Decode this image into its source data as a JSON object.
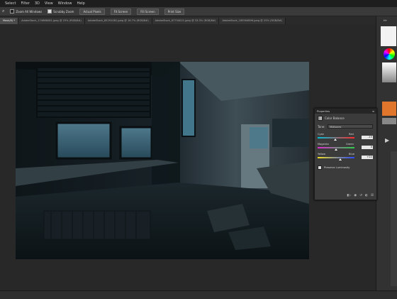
{
  "menubar": {
    "items": [
      "Select",
      "Filter",
      "3D",
      "View",
      "Window",
      "Help"
    ]
  },
  "options_bar": {
    "zoom_all_windows": "Zoom All Windows",
    "scrubby_zoom": "Scrubby Zoom",
    "actual_pixels": "Actual Pixels",
    "fit_screen": "Fit Screen",
    "fill_screen": "Fill Screen",
    "print_size": "Print Size"
  },
  "tabs": [
    {
      "label": "Mask/8) *"
    },
    {
      "label": "AdobeStock_174666081.jpeg @ 25% (RGB/8#)"
    },
    {
      "label": "AdobeStock_85291081.jpeg @ 16.7% (RGB/8#)"
    },
    {
      "label": "AdobeStock_67754021.jpeg @ 33.3% (RGB/8#)"
    },
    {
      "label": "AdobeStock_185564896.jpeg @ 25% (RGB/8#)"
    }
  ],
  "properties": {
    "panel_title": "Properties",
    "adjustment_name": "Color Balance",
    "tone_label": "Tone:",
    "tone_value": "Midtones",
    "sliders": [
      {
        "left": "Cyan",
        "right": "Red",
        "value": "-15",
        "level": -15
      },
      {
        "left": "Magenta",
        "right": "Green",
        "value": "0",
        "level": 0
      },
      {
        "left": "Yellow",
        "right": "Blue",
        "value": "+22",
        "level": 22
      }
    ],
    "preserve_luminosity": "Preserve Luminosity"
  },
  "colors": {
    "accent_orange": "#e0762b",
    "panel_bg": "#3b3b3b",
    "workspace_bg": "#282828"
  }
}
